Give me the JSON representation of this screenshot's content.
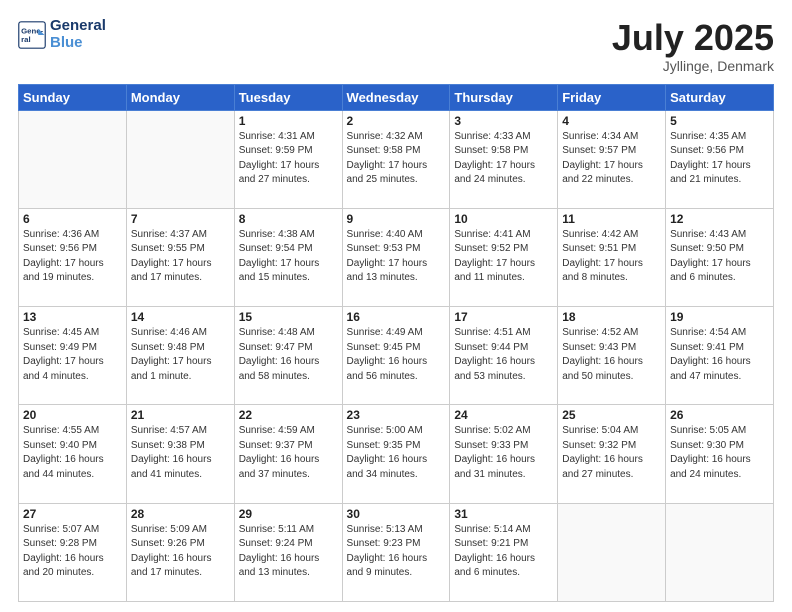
{
  "header": {
    "logo_line1": "General",
    "logo_line2": "Blue",
    "month": "July 2025",
    "location": "Jyllinge, Denmark"
  },
  "days_of_week": [
    "Sunday",
    "Monday",
    "Tuesday",
    "Wednesday",
    "Thursday",
    "Friday",
    "Saturday"
  ],
  "weeks": [
    [
      {
        "day": "",
        "info": ""
      },
      {
        "day": "",
        "info": ""
      },
      {
        "day": "1",
        "info": "Sunrise: 4:31 AM\nSunset: 9:59 PM\nDaylight: 17 hours and 27 minutes."
      },
      {
        "day": "2",
        "info": "Sunrise: 4:32 AM\nSunset: 9:58 PM\nDaylight: 17 hours and 25 minutes."
      },
      {
        "day": "3",
        "info": "Sunrise: 4:33 AM\nSunset: 9:58 PM\nDaylight: 17 hours and 24 minutes."
      },
      {
        "day": "4",
        "info": "Sunrise: 4:34 AM\nSunset: 9:57 PM\nDaylight: 17 hours and 22 minutes."
      },
      {
        "day": "5",
        "info": "Sunrise: 4:35 AM\nSunset: 9:56 PM\nDaylight: 17 hours and 21 minutes."
      }
    ],
    [
      {
        "day": "6",
        "info": "Sunrise: 4:36 AM\nSunset: 9:56 PM\nDaylight: 17 hours and 19 minutes."
      },
      {
        "day": "7",
        "info": "Sunrise: 4:37 AM\nSunset: 9:55 PM\nDaylight: 17 hours and 17 minutes."
      },
      {
        "day": "8",
        "info": "Sunrise: 4:38 AM\nSunset: 9:54 PM\nDaylight: 17 hours and 15 minutes."
      },
      {
        "day": "9",
        "info": "Sunrise: 4:40 AM\nSunset: 9:53 PM\nDaylight: 17 hours and 13 minutes."
      },
      {
        "day": "10",
        "info": "Sunrise: 4:41 AM\nSunset: 9:52 PM\nDaylight: 17 hours and 11 minutes."
      },
      {
        "day": "11",
        "info": "Sunrise: 4:42 AM\nSunset: 9:51 PM\nDaylight: 17 hours and 8 minutes."
      },
      {
        "day": "12",
        "info": "Sunrise: 4:43 AM\nSunset: 9:50 PM\nDaylight: 17 hours and 6 minutes."
      }
    ],
    [
      {
        "day": "13",
        "info": "Sunrise: 4:45 AM\nSunset: 9:49 PM\nDaylight: 17 hours and 4 minutes."
      },
      {
        "day": "14",
        "info": "Sunrise: 4:46 AM\nSunset: 9:48 PM\nDaylight: 17 hours and 1 minute."
      },
      {
        "day": "15",
        "info": "Sunrise: 4:48 AM\nSunset: 9:47 PM\nDaylight: 16 hours and 58 minutes."
      },
      {
        "day": "16",
        "info": "Sunrise: 4:49 AM\nSunset: 9:45 PM\nDaylight: 16 hours and 56 minutes."
      },
      {
        "day": "17",
        "info": "Sunrise: 4:51 AM\nSunset: 9:44 PM\nDaylight: 16 hours and 53 minutes."
      },
      {
        "day": "18",
        "info": "Sunrise: 4:52 AM\nSunset: 9:43 PM\nDaylight: 16 hours and 50 minutes."
      },
      {
        "day": "19",
        "info": "Sunrise: 4:54 AM\nSunset: 9:41 PM\nDaylight: 16 hours and 47 minutes."
      }
    ],
    [
      {
        "day": "20",
        "info": "Sunrise: 4:55 AM\nSunset: 9:40 PM\nDaylight: 16 hours and 44 minutes."
      },
      {
        "day": "21",
        "info": "Sunrise: 4:57 AM\nSunset: 9:38 PM\nDaylight: 16 hours and 41 minutes."
      },
      {
        "day": "22",
        "info": "Sunrise: 4:59 AM\nSunset: 9:37 PM\nDaylight: 16 hours and 37 minutes."
      },
      {
        "day": "23",
        "info": "Sunrise: 5:00 AM\nSunset: 9:35 PM\nDaylight: 16 hours and 34 minutes."
      },
      {
        "day": "24",
        "info": "Sunrise: 5:02 AM\nSunset: 9:33 PM\nDaylight: 16 hours and 31 minutes."
      },
      {
        "day": "25",
        "info": "Sunrise: 5:04 AM\nSunset: 9:32 PM\nDaylight: 16 hours and 27 minutes."
      },
      {
        "day": "26",
        "info": "Sunrise: 5:05 AM\nSunset: 9:30 PM\nDaylight: 16 hours and 24 minutes."
      }
    ],
    [
      {
        "day": "27",
        "info": "Sunrise: 5:07 AM\nSunset: 9:28 PM\nDaylight: 16 hours and 20 minutes."
      },
      {
        "day": "28",
        "info": "Sunrise: 5:09 AM\nSunset: 9:26 PM\nDaylight: 16 hours and 17 minutes."
      },
      {
        "day": "29",
        "info": "Sunrise: 5:11 AM\nSunset: 9:24 PM\nDaylight: 16 hours and 13 minutes."
      },
      {
        "day": "30",
        "info": "Sunrise: 5:13 AM\nSunset: 9:23 PM\nDaylight: 16 hours and 9 minutes."
      },
      {
        "day": "31",
        "info": "Sunrise: 5:14 AM\nSunset: 9:21 PM\nDaylight: 16 hours and 6 minutes."
      },
      {
        "day": "",
        "info": ""
      },
      {
        "day": "",
        "info": ""
      }
    ]
  ]
}
